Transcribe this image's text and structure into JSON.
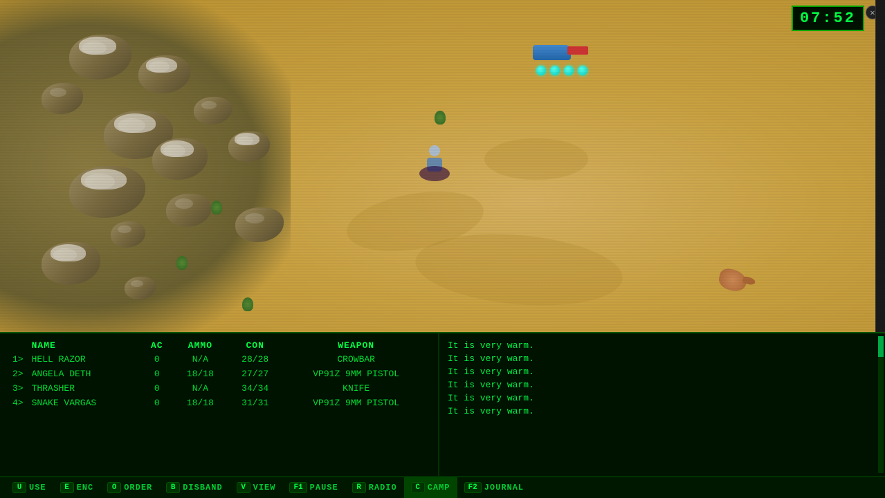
{
  "timer": {
    "value": "07:52"
  },
  "party": {
    "headers": {
      "name": "NAME",
      "ac": "AC",
      "ammo": "AMMO",
      "con": "CON",
      "weapon": "WEAPON"
    },
    "members": [
      {
        "num": "1>",
        "name": "HELL RAZOR",
        "ac": "0",
        "ammo": "N/A",
        "con": "28/28",
        "weapon": "CROWBAR"
      },
      {
        "num": "2>",
        "name": "ANGELA DETH",
        "ac": "0",
        "ammo": "18/18",
        "con": "27/27",
        "weapon": "VP91Z 9MM PISTOL"
      },
      {
        "num": "3>",
        "name": "THRASHER",
        "ac": "0",
        "ammo": "N/A",
        "con": "34/34",
        "weapon": "KNIFE"
      },
      {
        "num": "4>",
        "name": "SNAKE VARGAS",
        "ac": "0",
        "ammo": "18/18",
        "con": "31/31",
        "weapon": "VP91Z 9MM PISTOL"
      }
    ]
  },
  "log": {
    "lines": [
      "It is very warm.",
      "It is very warm.",
      "It is very warm.",
      "It is very warm.",
      "It is very warm.",
      "It is very warm."
    ]
  },
  "toolbar": {
    "items": [
      {
        "key": "U",
        "label": "USE"
      },
      {
        "key": "E",
        "label": "ENC"
      },
      {
        "key": "O",
        "label": "ORDER"
      },
      {
        "key": "B",
        "label": "DISBAND"
      },
      {
        "key": "V",
        "label": "VIEW"
      },
      {
        "key": "F1",
        "label": "PAUSE"
      },
      {
        "key": "R",
        "label": "RADIO"
      },
      {
        "key": "C",
        "label": "CAMP"
      },
      {
        "key": "F2",
        "label": "JOURNAL"
      }
    ]
  }
}
